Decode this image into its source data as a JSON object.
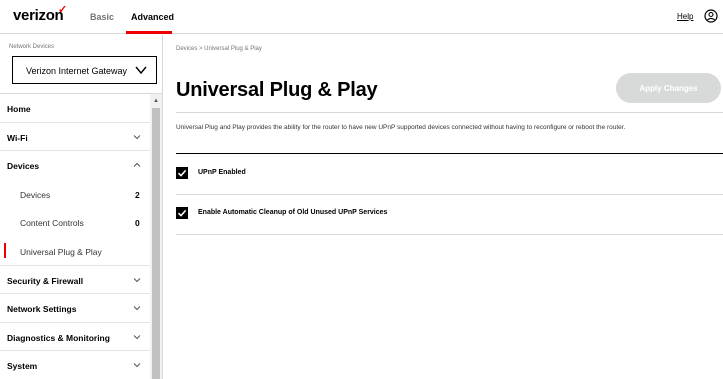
{
  "header": {
    "logo": "verizon",
    "tabs": [
      {
        "label": "Basic",
        "active": false
      },
      {
        "label": "Advanced",
        "active": true
      }
    ],
    "help_label": "Help",
    "accent_color": "#ee0000"
  },
  "sidebar": {
    "network_devices_label": "Network Devices",
    "selected_device": "Verizon Internet Gateway",
    "items": [
      {
        "label": "Home",
        "type": "section",
        "icon": null
      },
      {
        "label": "Wi-Fi",
        "type": "section",
        "icon": "chevron-down-icon"
      },
      {
        "label": "Devices",
        "type": "section",
        "icon": "chevron-up-icon"
      },
      {
        "label": "Devices",
        "type": "sub",
        "count": "2"
      },
      {
        "label": "Content Controls",
        "type": "sub",
        "count": "0"
      },
      {
        "label": "Universal Plug & Play",
        "type": "sub",
        "active": true
      },
      {
        "label": "Security & Firewall",
        "type": "section",
        "icon": "chevron-down-icon"
      },
      {
        "label": "Network Settings",
        "type": "section",
        "icon": "chevron-down-icon"
      },
      {
        "label": "Diagnostics & Monitoring",
        "type": "section",
        "icon": "chevron-down-icon"
      },
      {
        "label": "System",
        "type": "section",
        "icon": "chevron-down-icon"
      }
    ]
  },
  "main": {
    "breadcrumb": "Devices > Universal Plug & Play",
    "title": "Universal Plug & Play",
    "apply_label": "Apply Changes",
    "description": "Universal Plug and Play provides the ability for the router to have new UPnP supported devices connected without having to reconfigure or reboot the router.",
    "options": [
      {
        "label": "UPnP Enabled",
        "checked": true
      },
      {
        "label": "Enable Automatic Cleanup of Old Unused UPnP Services",
        "checked": true
      }
    ]
  }
}
